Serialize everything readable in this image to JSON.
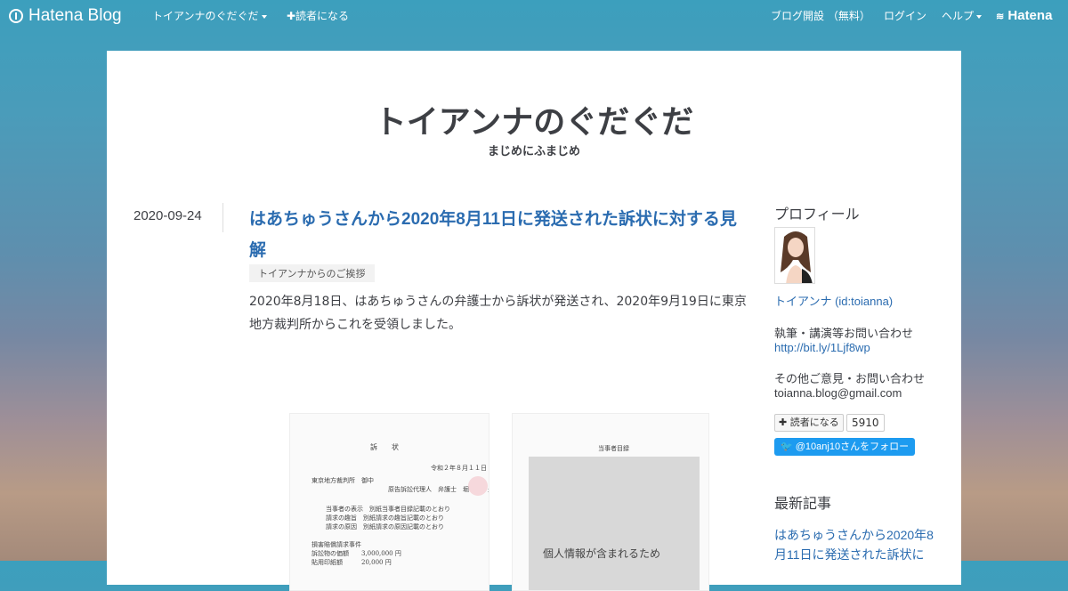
{
  "topbar": {
    "logo": "Hatena Blog",
    "blog_menu": "トイアンナのぐだぐだ",
    "subscribe": "✚読者になる",
    "open_blog": "ブログ開設 （無料）",
    "login": "ログイン",
    "help": "ヘルプ",
    "hatena": "Hatena"
  },
  "blog": {
    "title": "トイアンナのぐだぐだ",
    "description": "まじめにふまじめ"
  },
  "entry": {
    "date": "2020-09-24",
    "title": "はあちゅうさんから2020年8月11日に発送された訴状に対する見解",
    "category": "トイアンナからのご挨拶",
    "body": "2020年8月18日、はあちゅうさんの弁護士から訴状が発送され、2020年9月19日に東京地方裁判所からこれを受領しました。",
    "doc1": {
      "heading": "訴　　状",
      "date": "令和２年８月１１日",
      "court": "東京地方裁判所　御中",
      "agent": "原告訴訟代理人　弁護士　堀　　　光",
      "rows": [
        "当事者の表示　別紙当事者目録記載のとおり",
        "請求の趣旨　別紙請求の趣旨記載のとおり",
        "請求の原因　別紙請求の原因記載のとおり"
      ],
      "case": "損害賠償請求事件",
      "amount": "訴訟物の価額　　3,000,000 円",
      "fee": "貼用印紙額　　　20,000 円"
    },
    "doc2": {
      "heading": "当事者目録",
      "notice": "個人情報が含まれるため"
    }
  },
  "sidebar": {
    "profile_heading": "プロフィール",
    "profile_name": "トイアンナ (id:toianna)",
    "contact1_label": "執筆・講演等お問い合わせ",
    "contact1_link": "http://bit.ly/1Ljf8wp",
    "contact2_label": "その他ご意見・お問い合わせ",
    "contact2_email": "toianna.blog@gmail.com",
    "subscribe_label": "✚ 読者になる",
    "subscriber_count": "5910",
    "twitter_label": "@10anj10さんをフォロー",
    "recent_heading": "最新記事",
    "recent_item": "はあちゅうさんから2020年8月11日に発送された訴状に"
  },
  "colors": {
    "accent": "#2b6cb0",
    "twitter": "#1d9bf0",
    "text": "#3d3f44"
  }
}
